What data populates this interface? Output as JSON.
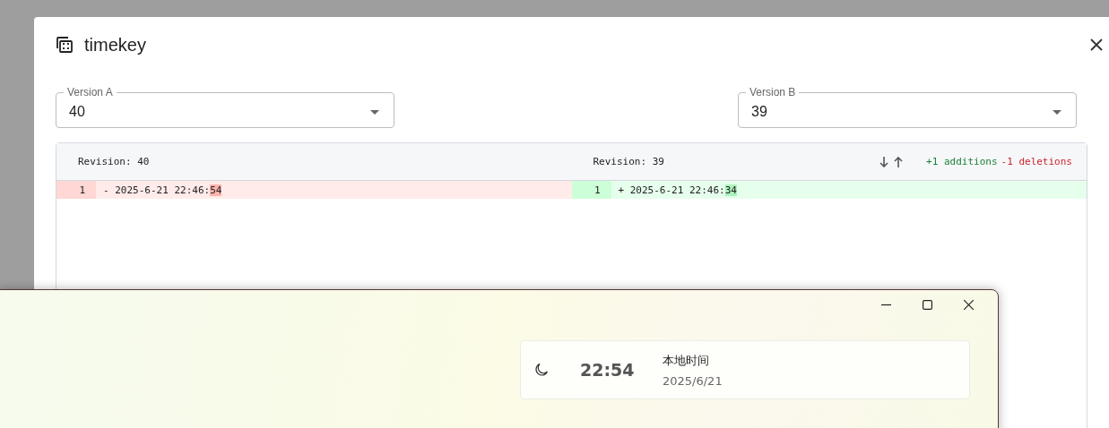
{
  "dialog": {
    "title": "timekey",
    "selects": [
      {
        "label": "Version A",
        "value": "40"
      },
      {
        "label": "Version B",
        "value": "39"
      }
    ],
    "diff": {
      "sides": [
        {
          "kind": "removed",
          "header": "Revision: 40",
          "lines": [
            {
              "number": "1",
              "sign": "-",
              "text": "2025-6-21 22:46:",
              "changed": "54"
            }
          ]
        },
        {
          "kind": "added",
          "header": "Revision: 39",
          "lines": [
            {
              "number": "1",
              "sign": "+",
              "text": "2025-6-21 22:46:",
              "changed": "34"
            }
          ]
        }
      ],
      "additions": "+1 additions",
      "deletions": "-1 deletions"
    }
  },
  "clock_window": {
    "time": "22:54",
    "label": "本地时间",
    "date": "2025/6/21"
  }
}
